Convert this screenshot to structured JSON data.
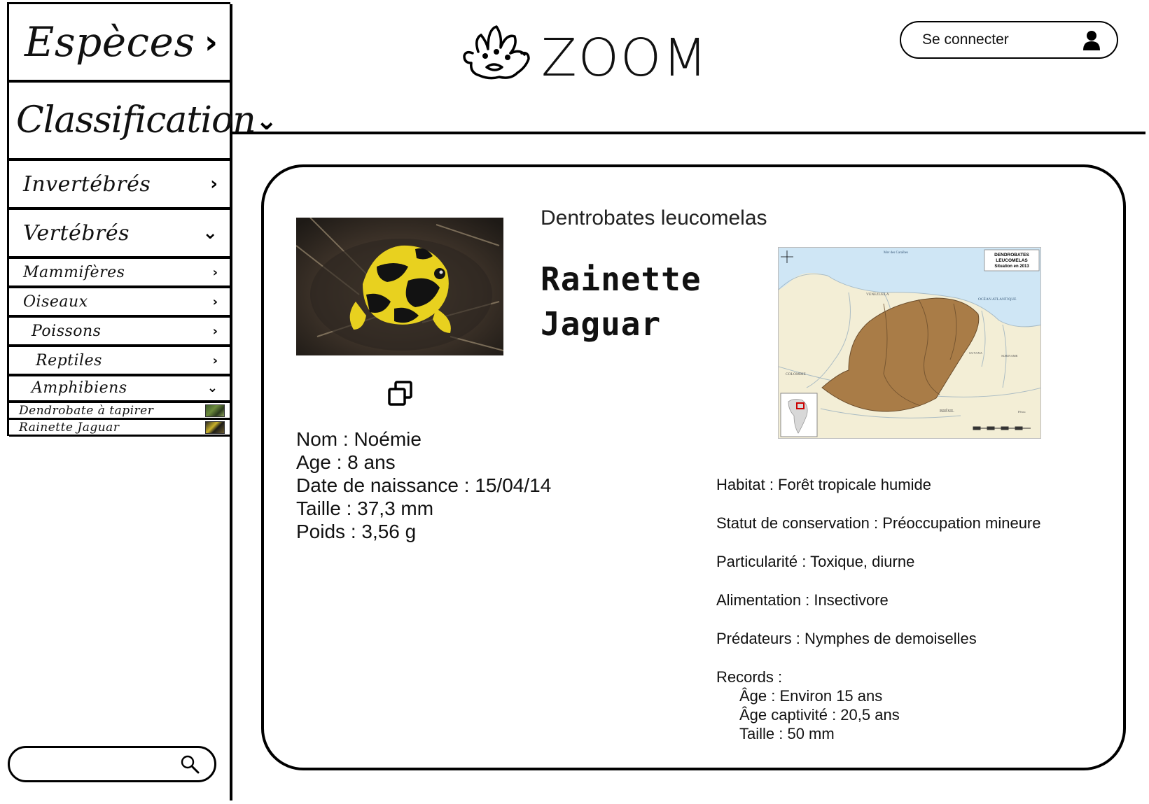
{
  "sidebar": {
    "especes": "Espèces",
    "classification": "Classification",
    "invertebres": "Invertébrés",
    "vertebres": "Vertébrés",
    "mammiferes": "Mammifères",
    "oiseaux": "Oiseaux",
    "poissons": "Poissons",
    "reptiles": "Reptiles",
    "amphibiens": "Amphibiens",
    "dendrobate": "Dendrobate à tapirer",
    "rainette": "Rainette Jaguar"
  },
  "header": {
    "logo_text": "ZOOM",
    "login_label": "Se connecter"
  },
  "animal": {
    "scientific_name": "Dentrobates leucomelas",
    "common_name_line1": "Rainette",
    "common_name_line2": "Jaguar",
    "nom": "Nom : Noémie",
    "age": "Age : 8 ans",
    "naissance": "Date de naissance : 15/04/14",
    "taille": "Taille : 37,3 mm",
    "poids": "Poids : 3,56 g",
    "habitat": "Habitat : Forêt tropicale humide",
    "statut": "Statut de conservation : Préoccupation mineure",
    "particularite": "Particularité : Toxique, diurne",
    "alimentation": "Alimentation : Insectivore",
    "predateurs": "Prédateurs : Nymphes de demoiselles",
    "records_title": "Records :",
    "records": [
      "Âge : Environ 15 ans",
      "Âge captivité : 20,5 ans",
      "Taille : 50 mm"
    ]
  },
  "map": {
    "title_line1": "DENDROBATES",
    "title_line2": "LEUCOMELAS",
    "title_line3": "Situation en 2013",
    "sea_label": "Mer des Caraïbes",
    "ocean_label": "OCÉAN ATLANTIQUE",
    "venezuela": "VENEZUELA",
    "colombie": "COLOMBIE",
    "bresil": "BRÉSIL",
    "guyana": "GUYANA",
    "suriname": "SURINAME",
    "perou": "Pérou",
    "land_color": "#f3eed6",
    "sea_color": "#cfe6f5",
    "range_color": "#a97c47"
  },
  "colors": {
    "frog_yellow": "#e8d11f",
    "frog_black": "#121212"
  },
  "icons": {
    "search": "search-icon",
    "user": "user-icon",
    "copy": "copy-icon"
  }
}
